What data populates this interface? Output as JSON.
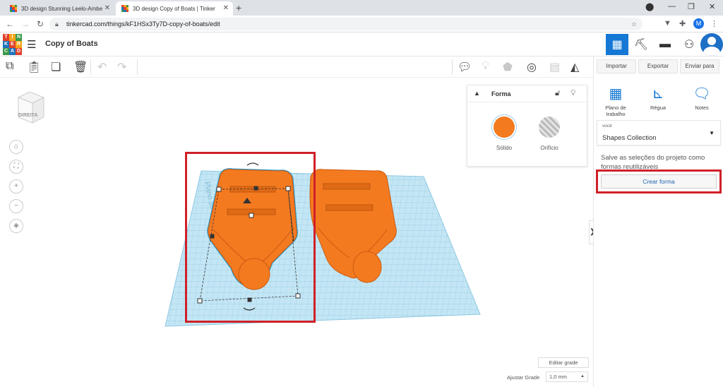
{
  "browser": {
    "tabs": [
      {
        "title": "3D design Stunning Leelo-Ambe",
        "active": false
      },
      {
        "title": "3D design Copy of Boats | Tinker",
        "active": true
      }
    ],
    "url": "tinkercad.com/things/kF1HSx3Ty7D-copy-of-boats/edit",
    "profile_initial": "M"
  },
  "app": {
    "logo_letters": [
      "T",
      "I",
      "N",
      "K",
      "E",
      "R",
      "C",
      "A",
      "D"
    ],
    "project_title": "Copy of Boats"
  },
  "shape_panel": {
    "title": "Forma",
    "solid_label": "Sólido",
    "hole_label": "Orifício",
    "solid_color": "#f47a20"
  },
  "right_panel": {
    "import_label": "Importar",
    "export_label": "Exportar",
    "send_label": "Enviar para",
    "tools": [
      {
        "label": "Plano de trabalho",
        "icon": "workplane-icon"
      },
      {
        "label": "Régua",
        "icon": "ruler-icon"
      },
      {
        "label": "Notes",
        "icon": "notes-icon"
      }
    ],
    "dropdown_owner": "você",
    "dropdown_value": "Shapes Collection",
    "hint_text": "Salve as seleções do projeto como formas reutilizáveis",
    "create_label": "Crear forma"
  },
  "workspace": {
    "viewcube_label": "DIREITA",
    "workplane_label": "Plano de trabalho",
    "edit_grid_label": "Editar grade",
    "snap_label": "Ajustar Grade",
    "snap_value": "1,0 mm"
  },
  "colors": {
    "accent_blue": "#1478d4",
    "highlight_red": "#d02028",
    "boat_orange": "#f47a20",
    "grid_blue": "#a9d8ee"
  }
}
